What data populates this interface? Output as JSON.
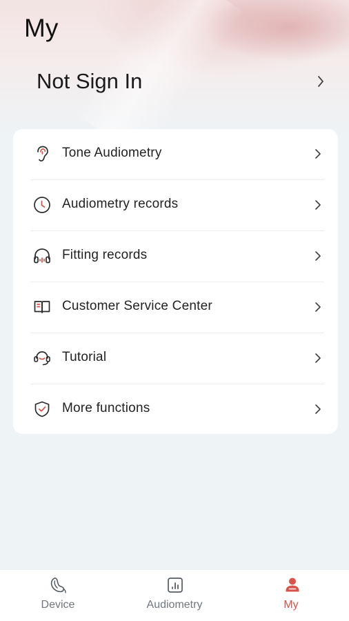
{
  "header": {
    "title": "My",
    "sign_in_label": "Not Sign In"
  },
  "menu": {
    "items": [
      {
        "label": "Tone Audiometry",
        "icon": "ear-icon"
      },
      {
        "label": "Audiometry records",
        "icon": "clock-icon"
      },
      {
        "label": "Fitting records",
        "icon": "headphones-icon"
      },
      {
        "label": "Customer Service Center",
        "icon": "book-icon"
      },
      {
        "label": "Tutorial",
        "icon": "headset-support-icon"
      },
      {
        "label": "More functions",
        "icon": "shield-check-icon"
      }
    ]
  },
  "tabbar": {
    "tabs": [
      {
        "label": "Device",
        "icon": "hearing-aid-icon",
        "active": false
      },
      {
        "label": "Audiometry",
        "icon": "bar-chart-icon",
        "active": false
      },
      {
        "label": "My",
        "icon": "person-icon",
        "active": true
      }
    ]
  },
  "colors": {
    "accent": "#d9534a",
    "icon_dark": "#2b2b2b",
    "background": "#eef3f6",
    "card": "#ffffff",
    "tab_inactive": "#707780"
  }
}
